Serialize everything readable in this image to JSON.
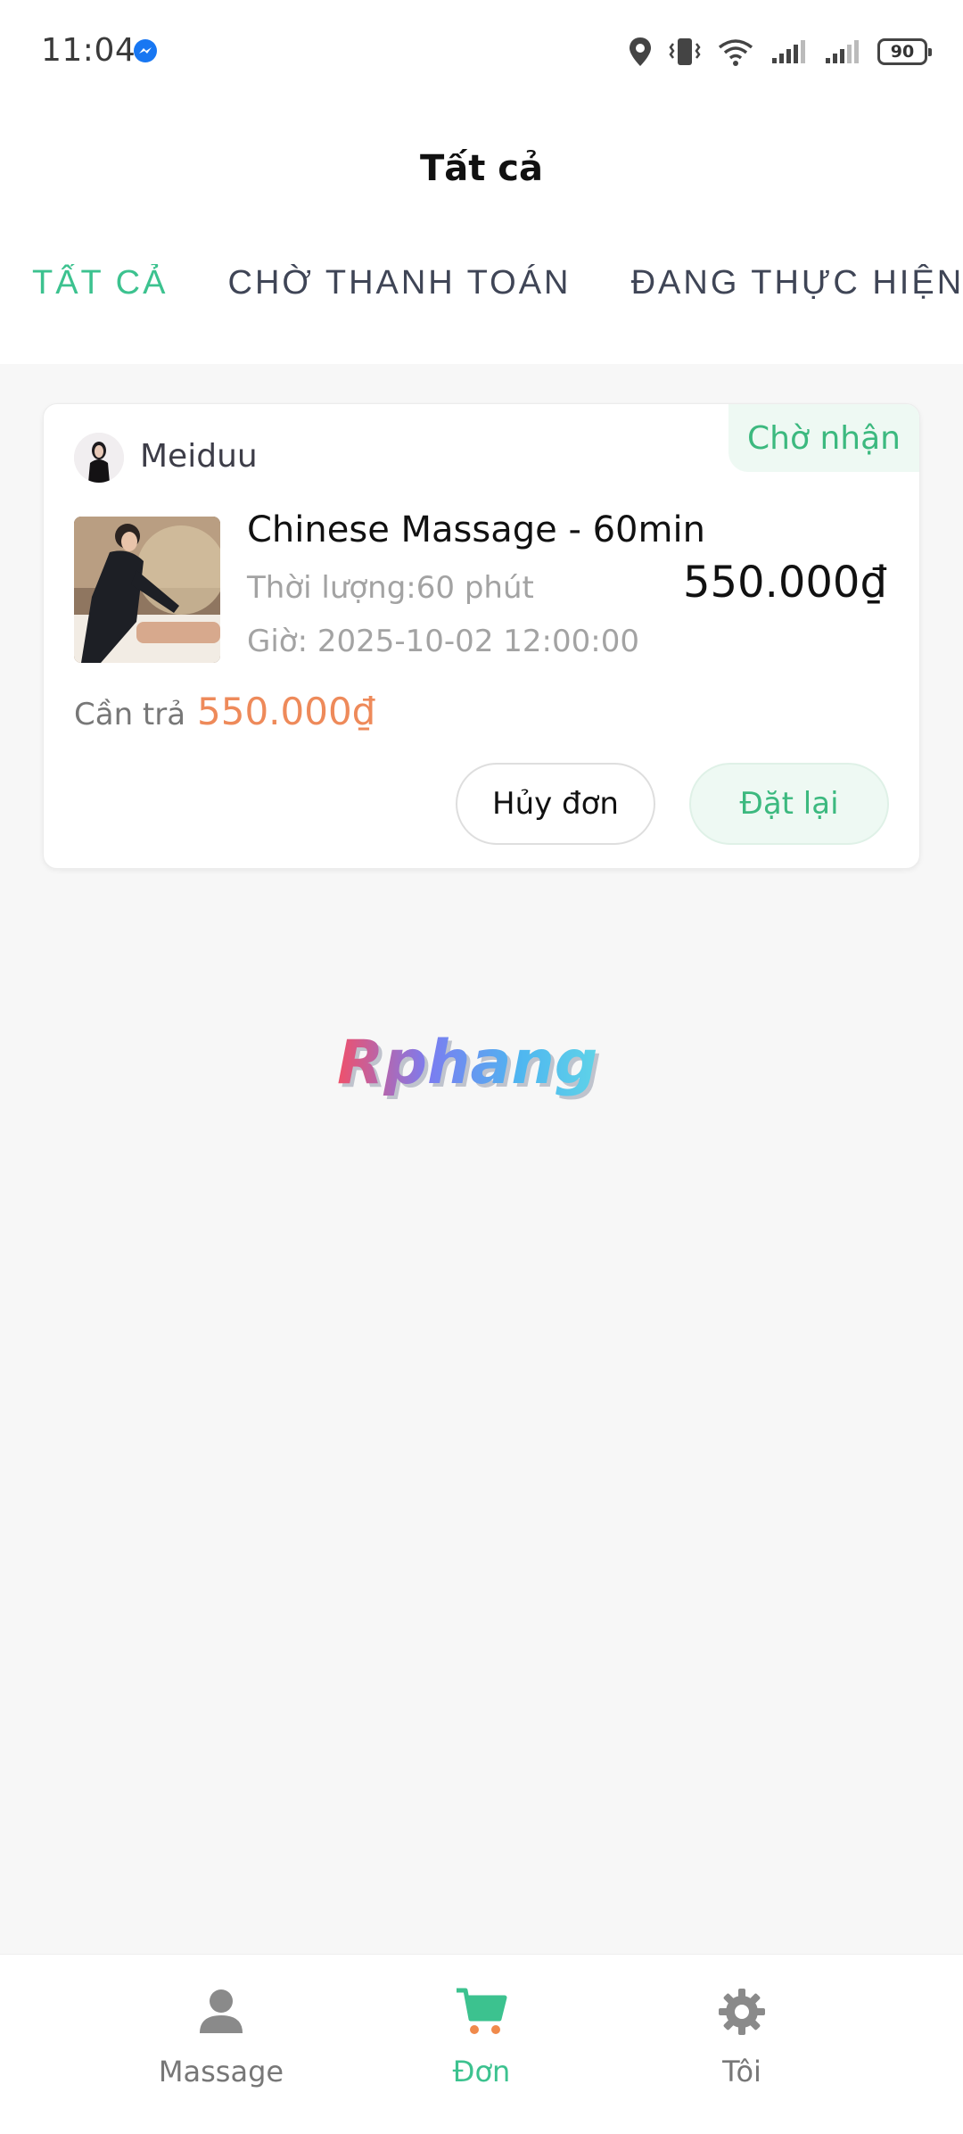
{
  "status_bar": {
    "time": "11:04",
    "battery": "90"
  },
  "header": {
    "title": "Tất cả"
  },
  "tabs": [
    {
      "label": "TẤT CẢ",
      "active": true
    },
    {
      "label": "CHỜ THANH TOÁN",
      "active": false
    },
    {
      "label": "ĐANG THỰC HIỆN",
      "active": false
    }
  ],
  "order": {
    "shop_name": "Meiduu",
    "status": "Chờ nhận",
    "product_title": "Chinese Massage - 60min",
    "duration": "Thời lượng:60 phút",
    "time": "Giờ: 2025-10-02 12:00:00",
    "price": "550.000₫",
    "pay_label": "Cần trả",
    "pay_amount": "550.000₫",
    "cancel_label": "Hủy đơn",
    "reorder_label": "Đặt lại"
  },
  "watermark": "Rphang",
  "bottom_nav": [
    {
      "label": "Massage",
      "icon": "person-icon",
      "active": false
    },
    {
      "label": "Đơn",
      "icon": "cart-icon",
      "active": true
    },
    {
      "label": "Tôi",
      "icon": "gear-icon",
      "active": false
    }
  ],
  "colors": {
    "accent": "#3cc28f",
    "price_orange": "#ee8a5a",
    "background": "#f7f7f7"
  }
}
